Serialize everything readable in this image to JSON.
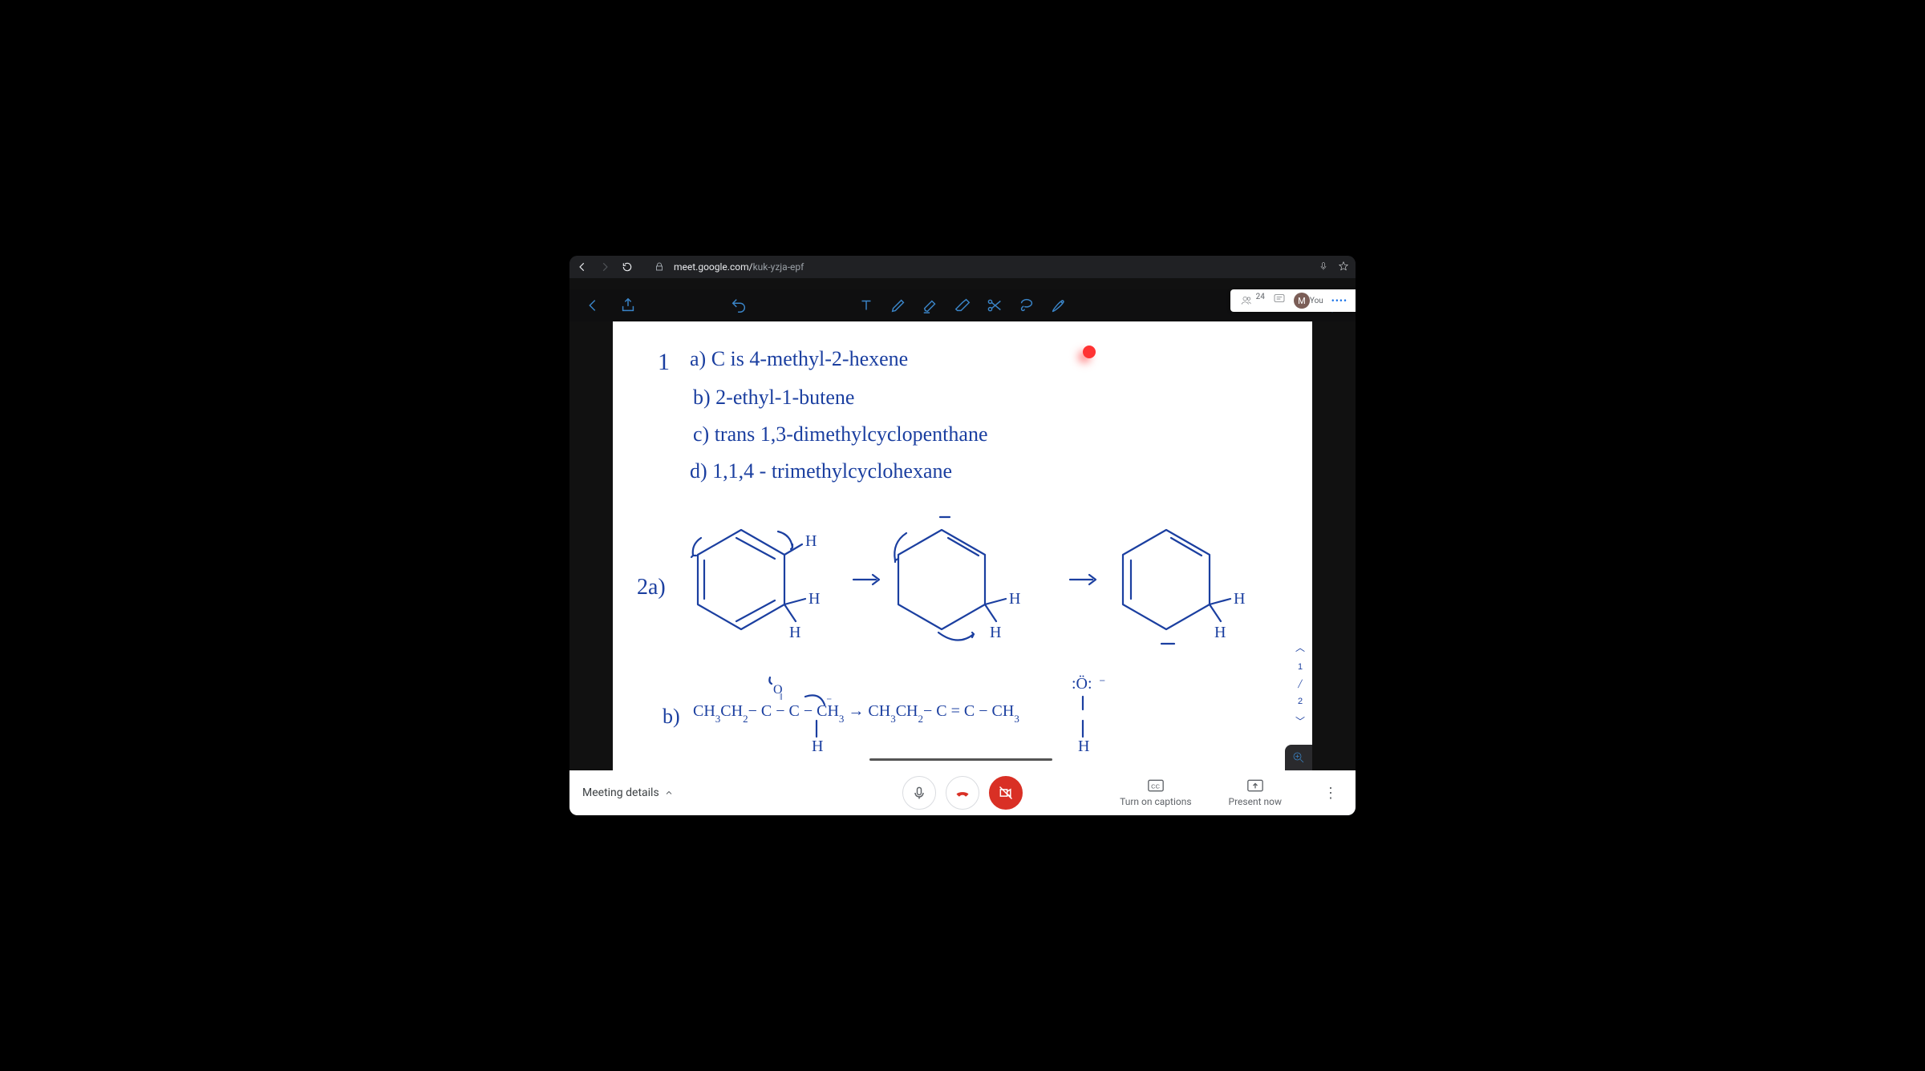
{
  "browser": {
    "url_prefix": "meet.google.com/",
    "url_path": "kuk-yzja-epf"
  },
  "participants": {
    "count": "24",
    "avatar_initial": "M",
    "you_label": "You"
  },
  "whiteboard": {
    "q1_num": "1",
    "line_a": "a)  C  is  4-methyl-2-hexene",
    "line_b": "b) 2-ethyl-1-butene",
    "line_c": "c) trans 1,3-dimethylcyclopenthane",
    "line_d": "d)  1,1,4 - trimethylcyclohexane",
    "q2_label": "2a)",
    "q2b_label": "b)",
    "page_current": "1",
    "page_total": "2"
  },
  "meetbar": {
    "details": "Meeting details",
    "captions": "Turn on captions",
    "present": "Present now"
  }
}
